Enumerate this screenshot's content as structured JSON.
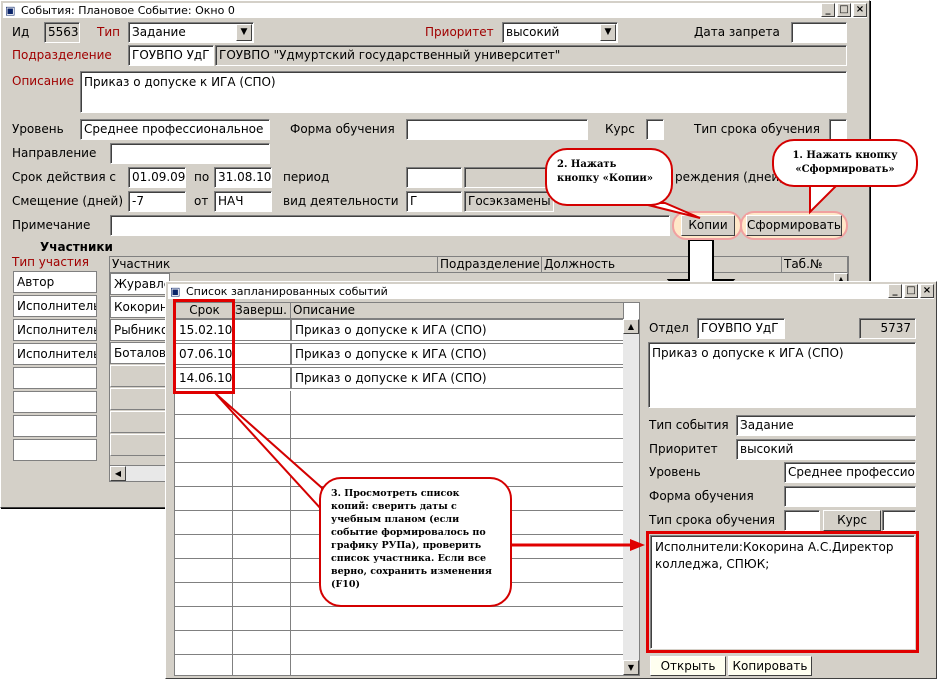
{
  "main": {
    "title": "События: Плановое Событие: Окно 0",
    "id_label": "Ид",
    "id_value": "5563",
    "type_label": "Тип",
    "type_value": "Задание",
    "priority_label": "Приоритет",
    "priority_value": "высокий",
    "ban_date_label": "Дата запрета",
    "division_label": "Подразделение",
    "division_code": "ГОУВПО УдГ",
    "division_name": "ГОУВПО  \"Удмуртский государственный университет\"",
    "description_label": "Описание",
    "description_value": "Приказ о допуске к ИГА (СПО)",
    "level_label": "Уровень",
    "level_value": "Среднее профессиональное",
    "study_form_label": "Форма обучения",
    "course_label": "Курс",
    "term_type_label": "Тип срока обучения",
    "direction_label": "Направление",
    "validity_label": "Срок действия с",
    "date_from": "01.09.09",
    "by_label": "по",
    "date_to": "31.08.10",
    "period_label": "период",
    "inst_label": "реждения (дней)",
    "offset_label": "Смещение (дней)",
    "offset_value": "-7",
    "from_label": "от",
    "from_value": "НАЧ",
    "activity_label": "вид деятельности",
    "activity_value": "Г",
    "gosexam_label": "Госэкзамены",
    "note_label": "Примечание",
    "copies_button": "Копии",
    "form_button": "Сформировать",
    "participants_label": "Участники",
    "part_type_label": "Тип участия",
    "part_types": [
      "Автор",
      "Исполнитель",
      "Исполнитель",
      "Исполнитель"
    ],
    "col_participant": "Участник",
    "col_division": "Подразделение",
    "col_position": "Должность",
    "col_tab": "Таб.№",
    "participants": [
      "Журавле",
      "Кокорин",
      "Рыбнико",
      "Боталова"
    ]
  },
  "sub": {
    "title": "Список запланированных событий",
    "col_deadline": "Срок",
    "col_done": "Заверш.",
    "col_description": "Описание",
    "rows": [
      {
        "deadline": "15.02.10",
        "description": "Приказ о допуске к ИГА (СПО)"
      },
      {
        "deadline": "07.06.10",
        "description": "Приказ о допуске к ИГА (СПО)"
      },
      {
        "deadline": "14.06.10",
        "description": "Приказ о допуске к ИГА (СПО)"
      }
    ],
    "dept_label": "Отдел",
    "dept_value": "ГОУВПО УдГ",
    "dept_id": "5737",
    "description_value": "Приказ о допуске к ИГА (СПО)",
    "event_type_label": "Тип события",
    "event_type_value": "Задание",
    "priority_label": "Приоритет",
    "priority_value": "высокий",
    "level_label": "Уровень",
    "level_value": "Среднее профессион",
    "study_form_label": "Форма обучения",
    "term_type_label": "Тип срока обучения",
    "course_button": "Курс",
    "executors_value": "Исполнители:Кокорина А.С.Директор колледжа, СПЮК;",
    "open_button": "Открыть",
    "copy_button": "Копировать"
  },
  "callouts": {
    "c1": "1. Нажать кнопку «Сформировать»",
    "c2": "2. Нажать кнопку «Копии»",
    "c3": "3. Просмотреть список копий: сверить даты с учебным планом (если событие формировалось по графику РУПа), проверить список участника. Если все верно, сохранить изменения (F10)"
  },
  "colors": {
    "accent_red": "#e00000",
    "label_red": "#a00000",
    "window_gray": "#d4d0c8"
  }
}
